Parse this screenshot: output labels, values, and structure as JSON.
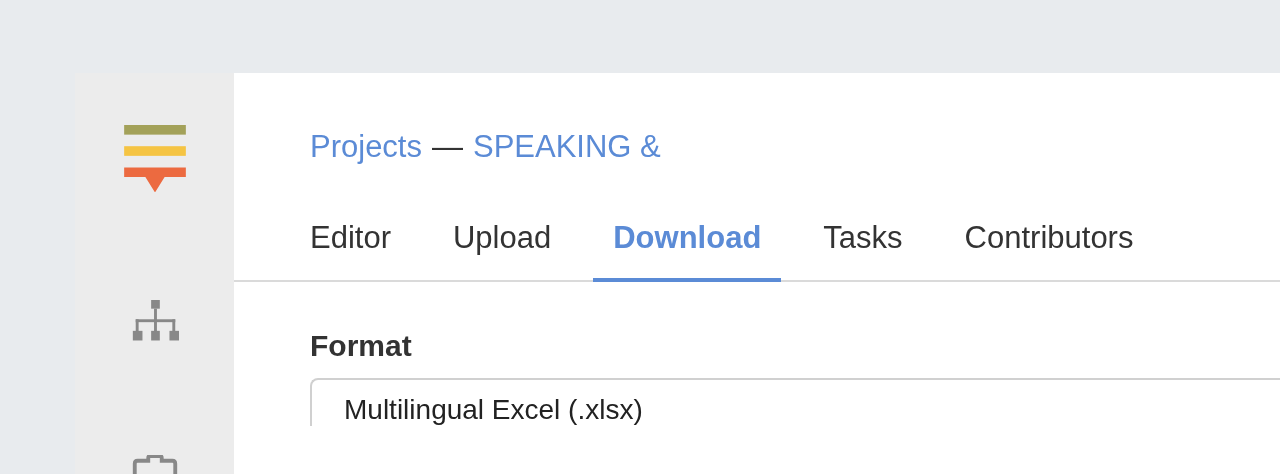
{
  "breadcrumb": {
    "items": [
      {
        "label": "Projects"
      },
      {
        "label": "SPEAKING &"
      }
    ],
    "separator": "—"
  },
  "tabs": [
    {
      "label": "Editor",
      "selected": false
    },
    {
      "label": "Upload",
      "selected": false
    },
    {
      "label": "Download",
      "selected": true
    },
    {
      "label": "Tasks",
      "selected": false
    },
    {
      "label": "Contributors",
      "selected": false
    }
  ],
  "format": {
    "label": "Format",
    "value": "Multilingual Excel (.xlsx)"
  }
}
